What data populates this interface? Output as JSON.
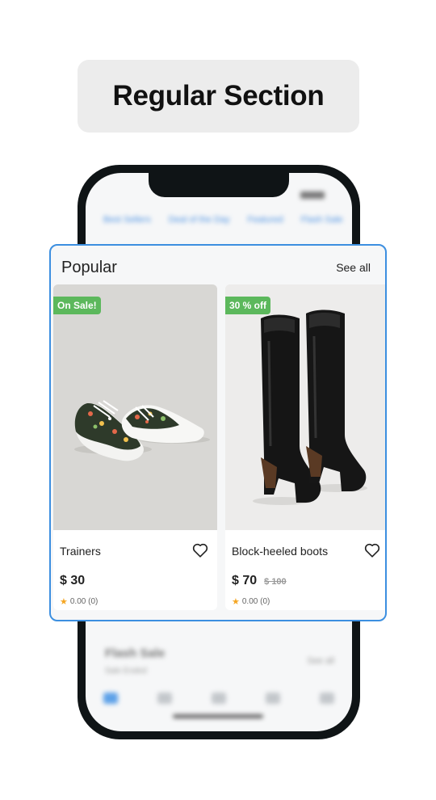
{
  "header": {
    "title": "Regular Section"
  },
  "phone_background": {
    "status_time": "",
    "tabs": [
      "Best Sellers",
      "Deal of the Day",
      "Featured",
      "Flash Sale"
    ],
    "flash_title": "Flash Sale",
    "flash_subtitle": "Sale Ended",
    "flash_see_all": "See all"
  },
  "section": {
    "title": "Popular",
    "see_all_label": "See all",
    "products": [
      {
        "name": "Trainers",
        "badge": "On Sale!",
        "price": "$ 30",
        "old_price": "",
        "rating": "0.00 (0)",
        "image_icon": "floral-sneakers-image",
        "favorite_icon": "heart-outline-icon"
      },
      {
        "name": "Block-heeled boots",
        "badge": "30 % off",
        "price": "$ 70",
        "old_price": "$ 100",
        "rating": "0.00 (0)",
        "image_icon": "black-knee-boots-image",
        "favorite_icon": "heart-outline-icon"
      }
    ]
  },
  "colors": {
    "accent_border": "#3c8fe0",
    "badge_green": "#5cb85c",
    "star": "#f5a623"
  }
}
